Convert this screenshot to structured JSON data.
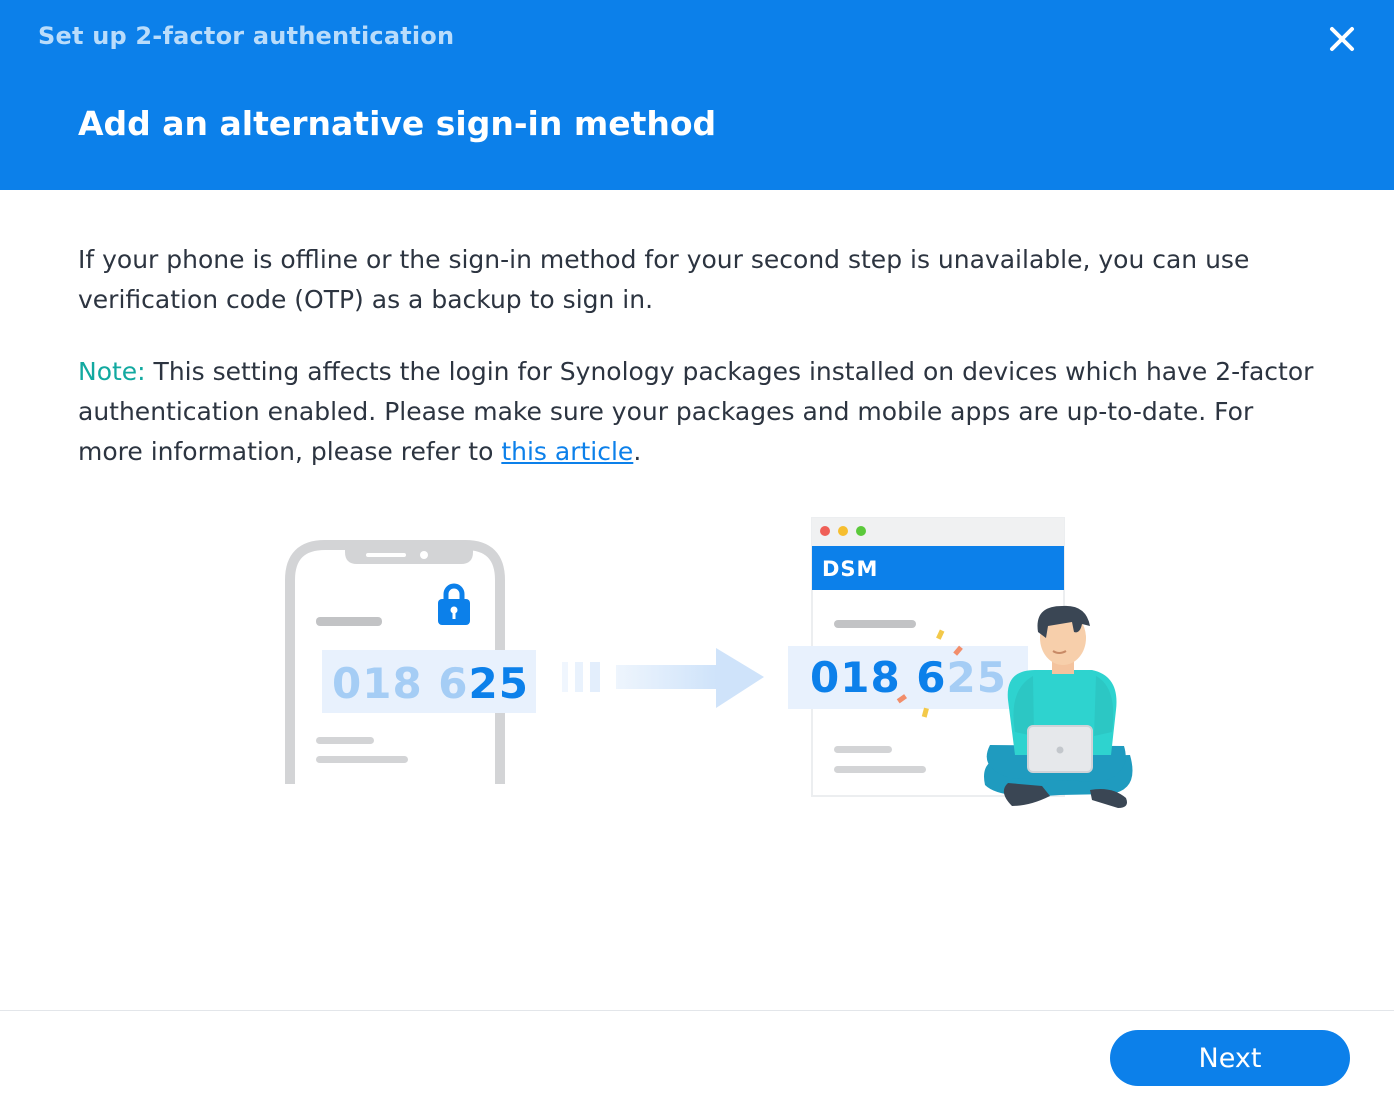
{
  "dialog": {
    "window_title": "Set up 2-factor authentication",
    "close_icon": "close-icon",
    "page_title": "Add an alternative sign-in method"
  },
  "content": {
    "intro": "If your phone is offline or the sign-in method for your second step is unavailable, you can use verification code (OTP) as a backup to sign in.",
    "note_label": "Note:",
    "note_text": " This setting affects the login for Synology packages installed on devices which have 2-factor authentication enabled. Please make sure your packages and mobile apps are up-to-date. For more information, please refer to ",
    "link_text": "this article",
    "note_end": "."
  },
  "illustration": {
    "phone_code_faded": "018 6",
    "phone_code_bold": "25",
    "app_label": "DSM",
    "dsm_code_bold": "018 6",
    "dsm_code_faded": "25"
  },
  "footer": {
    "next_label": "Next"
  },
  "colors": {
    "accent": "#0c80ea",
    "note": "#12a9a0",
    "text": "#2c3440"
  }
}
